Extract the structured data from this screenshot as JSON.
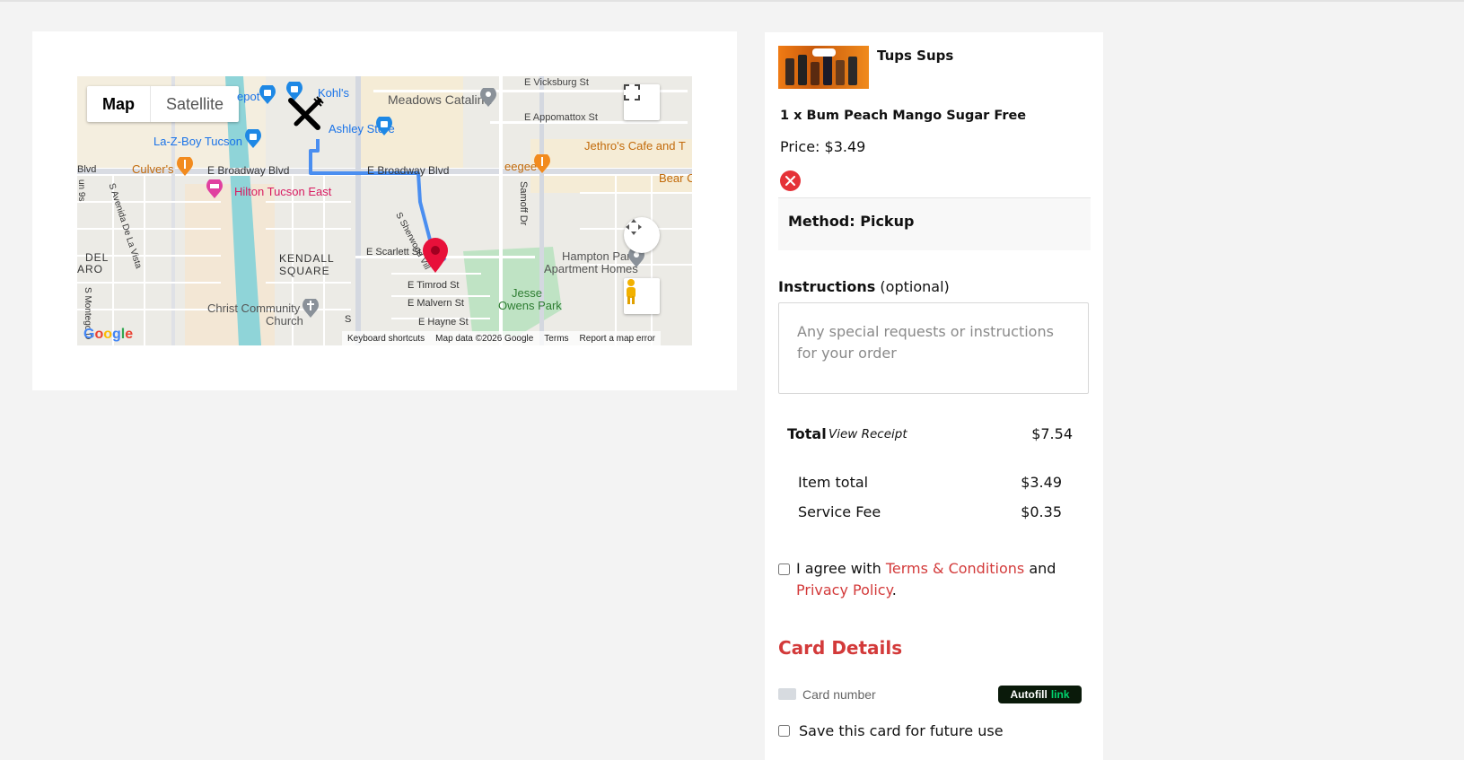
{
  "map": {
    "type_buttons": {
      "map": "Map",
      "satellite": "Satellite"
    },
    "labels": {
      "vicksburg": "E Vicksburg St",
      "meadows": "Meadows Catalina",
      "appomattox": "E Appomattox St",
      "kohls": "Kohl's",
      "depot": "epot",
      "ashley": "Ashley Store",
      "lazboy": "La-Z-Boy Tucson",
      "jethros": "Jethro's Cafe and T",
      "culvers": "Culver's",
      "blvd": "Blvd",
      "broadway1": "E Broadway Blvd",
      "broadway2": "E Broadway Blvd",
      "eegees": "eegee's",
      "bear": "Bear C",
      "hilton": "Hilton Tucson East",
      "sherwood": "S Sherwood Vill",
      "samoff": "Samoff Dr",
      "avenida": "S Avenida De La Vista",
      "del": "DEL",
      "aro": "ARO",
      "kendall1": "KENDALL",
      "kendall2": "SQUARE",
      "scarlett": "E Scarlett St",
      "hampton1": "Hampton Park",
      "hampton2": "Apartment Homes",
      "timrod": "E Timrod St",
      "malvern": "E Malvern St",
      "hayne": "E Hayne St",
      "jesse1": "Jesse",
      "jesse2": "Owens Park",
      "christ1": "Christ Community",
      "christ2": "Church",
      "montego": "S Montego D",
      "s": "S",
      "un": "un 9s"
    },
    "attribution": {
      "shortcuts": "Keyboard shortcuts",
      "mapdata": "Map data ©2026 Google",
      "terms": "Terms",
      "report": "Report a map error"
    },
    "logo": "Google"
  },
  "order": {
    "store_name": "Tups Sups",
    "item": "1 x Bum Peach Mango Sugar Free",
    "price": "Price: $3.49",
    "method": "Method: Pickup",
    "instructions_label": "Instructions",
    "instructions_optional": "(optional)",
    "instructions_placeholder": "Any special requests or instructions for your order",
    "total_label": "Total",
    "view_receipt": "View Receipt",
    "total_value": "$7.54",
    "item_total_label": "Item total",
    "item_total_value": "$3.49",
    "service_fee_label": "Service Fee",
    "service_fee_value": "$0.35",
    "agree_prefix": "I agree with",
    "terms_link": "Terms & Conditions",
    "and": "and",
    "privacy_link": "Privacy Policy",
    "period": ".",
    "card_details_title": "Card Details",
    "card_number_placeholder": "Card number",
    "autofill": "Autofill",
    "link": "link",
    "save_card": "Save this card for future use"
  },
  "colors": {
    "accent": "#d33a3a",
    "route": "#4a8ef0",
    "pin": "#e8103a",
    "park": "#bfe3c4"
  }
}
